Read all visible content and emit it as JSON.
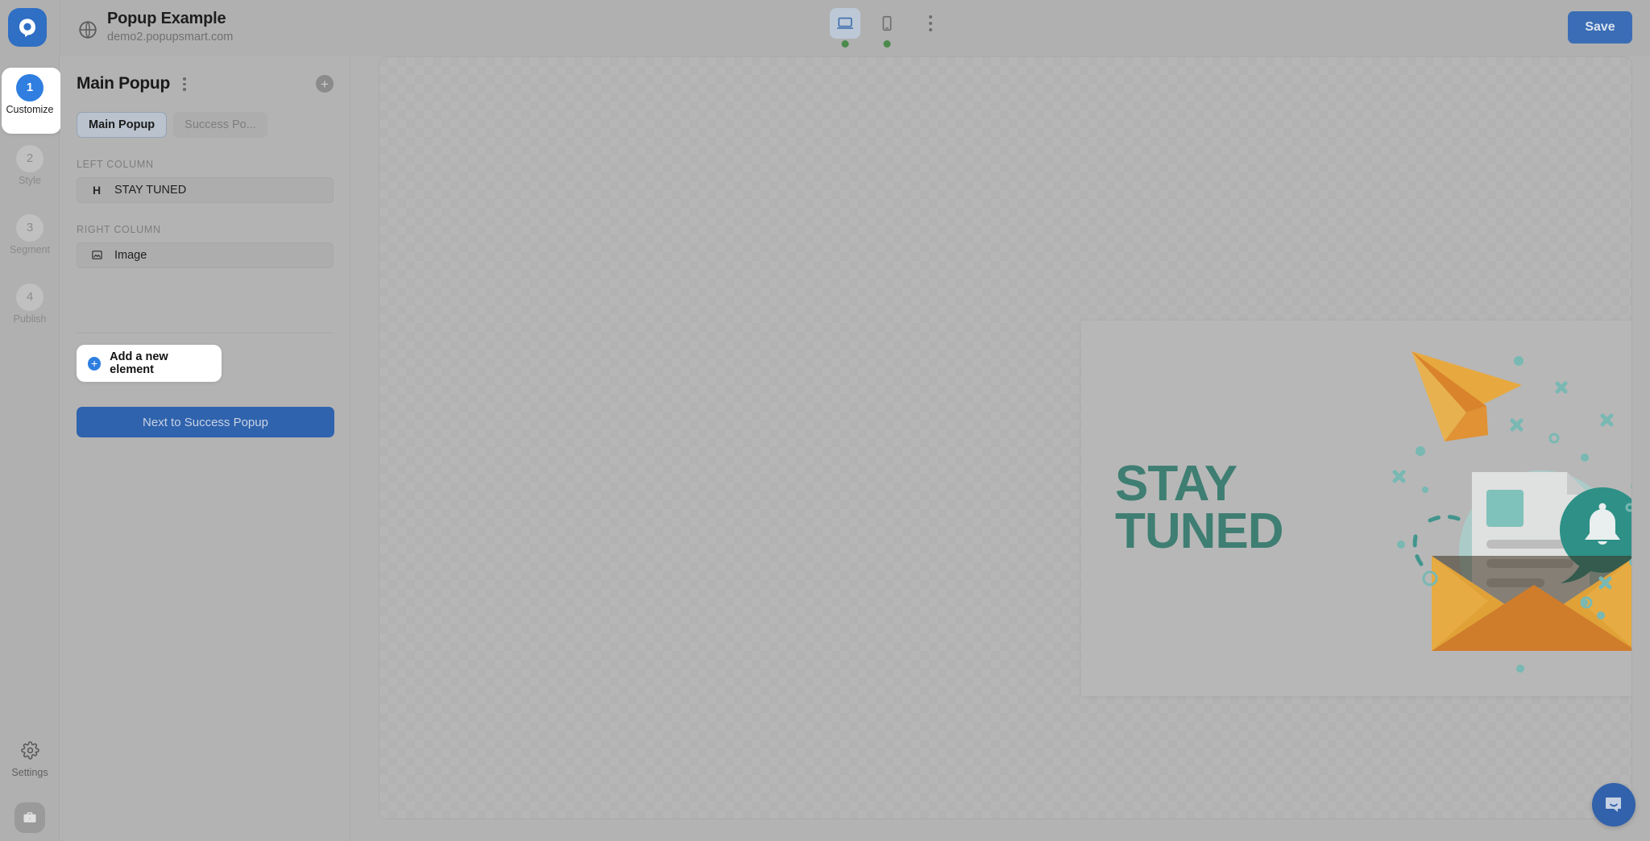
{
  "topbar": {
    "logo_icon": "popupsmart-logo-icon",
    "globe_icon": "globe-icon",
    "site_title": "Popup Example",
    "site_url": "demo2.popupsmart.com",
    "devices": [
      {
        "name": "desktop",
        "icon": "laptop-icon",
        "active": true,
        "status": "online"
      },
      {
        "name": "mobile",
        "icon": "mobile-phone-icon",
        "active": false,
        "status": "online"
      }
    ],
    "more_icon": "kebab-menu-icon",
    "save_label": "Save"
  },
  "rail": {
    "steps": [
      {
        "num": "1",
        "label": "Customize",
        "active": true
      },
      {
        "num": "2",
        "label": "Style",
        "active": false
      },
      {
        "num": "3",
        "label": "Segment",
        "active": false
      },
      {
        "num": "4",
        "label": "Publish",
        "active": false
      }
    ],
    "settings_label": "Settings",
    "settings_icon": "gear-icon",
    "avatar_icon": "briefcase-icon"
  },
  "panel": {
    "title": "Main Popup",
    "kebab_icon": "kebab-menu-icon",
    "add_circle_icon": "plus-circle-icon",
    "tabs": [
      {
        "label": "Main Popup",
        "active": true
      },
      {
        "label": "Success Po...",
        "active": false
      }
    ],
    "sections": [
      {
        "label": "LEFT COLUMN",
        "elements": [
          {
            "icon": "heading-icon",
            "icon_glyph": "H",
            "name": "STAY TUNED"
          }
        ]
      },
      {
        "label": "RIGHT COLUMN",
        "elements": [
          {
            "icon": "image-icon",
            "icon_glyph": "",
            "name": "Image"
          }
        ]
      }
    ],
    "add_element_label": "Add a new element",
    "add_element_icon": "plus-circle-icon",
    "next_button_label": "Next to Success Popup"
  },
  "canvas": {
    "popup": {
      "heading_line1": "STAY",
      "heading_line2": "TUNED",
      "heading_color": "#3f7e72",
      "close_icon": "close-icon",
      "illustration": "newsletter-subscribe-illustration"
    }
  },
  "chat": {
    "icon": "chat-bubble-icon"
  },
  "colors": {
    "accent_blue": "#2f7ee0",
    "button_blue": "#2f63ae",
    "save_blue": "#3a6db5",
    "teal": "#3f7e72",
    "status_green": "#4b8a4b",
    "orange": "#e2a03f"
  }
}
